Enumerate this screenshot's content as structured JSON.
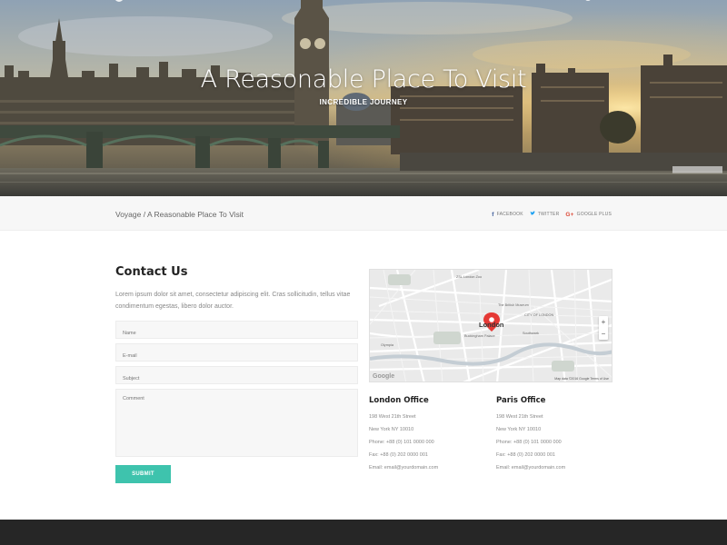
{
  "hero": {
    "title": "A Reasonable Place To Visit",
    "subtitle": "INCREDIBLE JOURNEY"
  },
  "breadcrumb": {
    "path": "Voyage / A Reasonable Place To Visit"
  },
  "share": {
    "facebook": {
      "icon": "facebook-icon",
      "label": "FACEBOOK",
      "glyph": "f"
    },
    "twitter": {
      "icon": "twitter-icon",
      "label": "TWITTER",
      "glyph": "🐦"
    },
    "googleplus": {
      "icon": "google-plus-icon",
      "label": "GOOGLE PLUS",
      "glyph": "G+"
    }
  },
  "contact": {
    "title": "Contact Us",
    "description": "Lorem ipsum dolor sit amet, consectetur adipiscing elit. Cras sollicitudin, tellus vitae condimentum egestas, libero dolor auctor.",
    "fields": {
      "name_placeholder": "Name",
      "email_placeholder": "E-mail",
      "subject_placeholder": "Subject",
      "comment_placeholder": "Comment"
    },
    "submit_label": "SUBMIT"
  },
  "map": {
    "city": "London",
    "labels": {
      "museum": "The British Museum",
      "palace": "Buckingham Palace",
      "southwark": "Southwark",
      "city_of_london": "CITY OF LONDON",
      "zoo": "ZSL London Zoo",
      "olympia": "Olympia"
    },
    "zoom_in": "+",
    "zoom_out": "−",
    "google": "Google",
    "footer": "Map data ©2016 Google    Terms of Use"
  },
  "offices": [
    {
      "title": "London Office",
      "street": "198 West 21th Street",
      "city": "New York NY 10010",
      "phone": "Phone: +88 (0) 101 0000 000",
      "fax": "Fax: +88 (0) 202 0000 001",
      "email": "Email: email@yourdomain.com"
    },
    {
      "title": "Paris Office",
      "street": "198 West 21th Street",
      "city": "New York NY 10010",
      "phone": "Phone: +88 (0) 101 0000 000",
      "fax": "Fax: +88 (0) 202 0000 001",
      "email": "Email: email@yourdomain.com"
    }
  ],
  "colors": {
    "accent": "#3ec3ad",
    "footer": "#262626",
    "map_pin": "#e53935"
  }
}
